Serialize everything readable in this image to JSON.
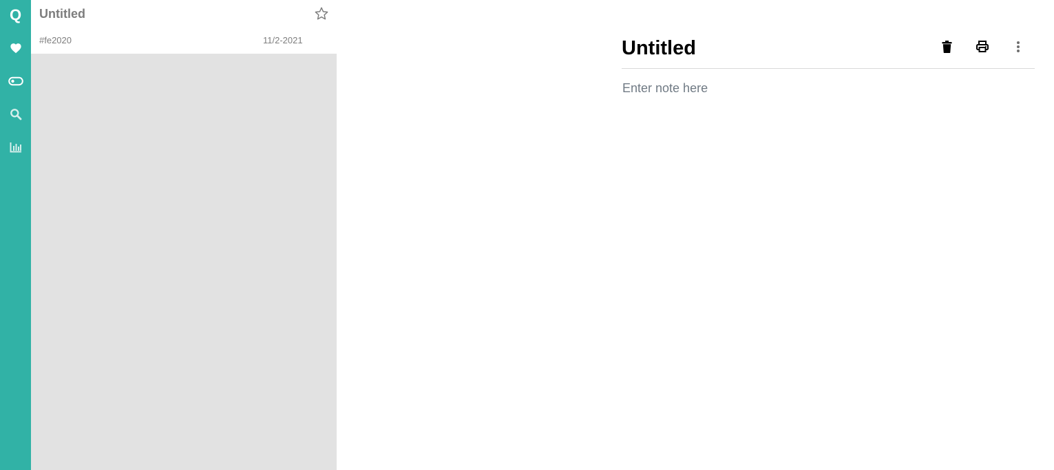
{
  "sidebar": {
    "logo": "Q",
    "items": [
      {
        "icon": "heart-icon"
      },
      {
        "icon": "toggle-icon"
      },
      {
        "icon": "search-icon"
      },
      {
        "icon": "chart-icon"
      }
    ],
    "accent_color": "#31b2a6"
  },
  "note_list": {
    "notes": [
      {
        "title": "Untitled",
        "tag": "#fe2020",
        "date": "11/2-2021",
        "starred": false
      }
    ]
  },
  "editor": {
    "title": "Untitled",
    "body_value": "",
    "body_placeholder": "Enter note here",
    "toolbar": [
      {
        "icon": "trash-icon"
      },
      {
        "icon": "print-icon"
      },
      {
        "icon": "more-vertical-icon"
      }
    ]
  }
}
